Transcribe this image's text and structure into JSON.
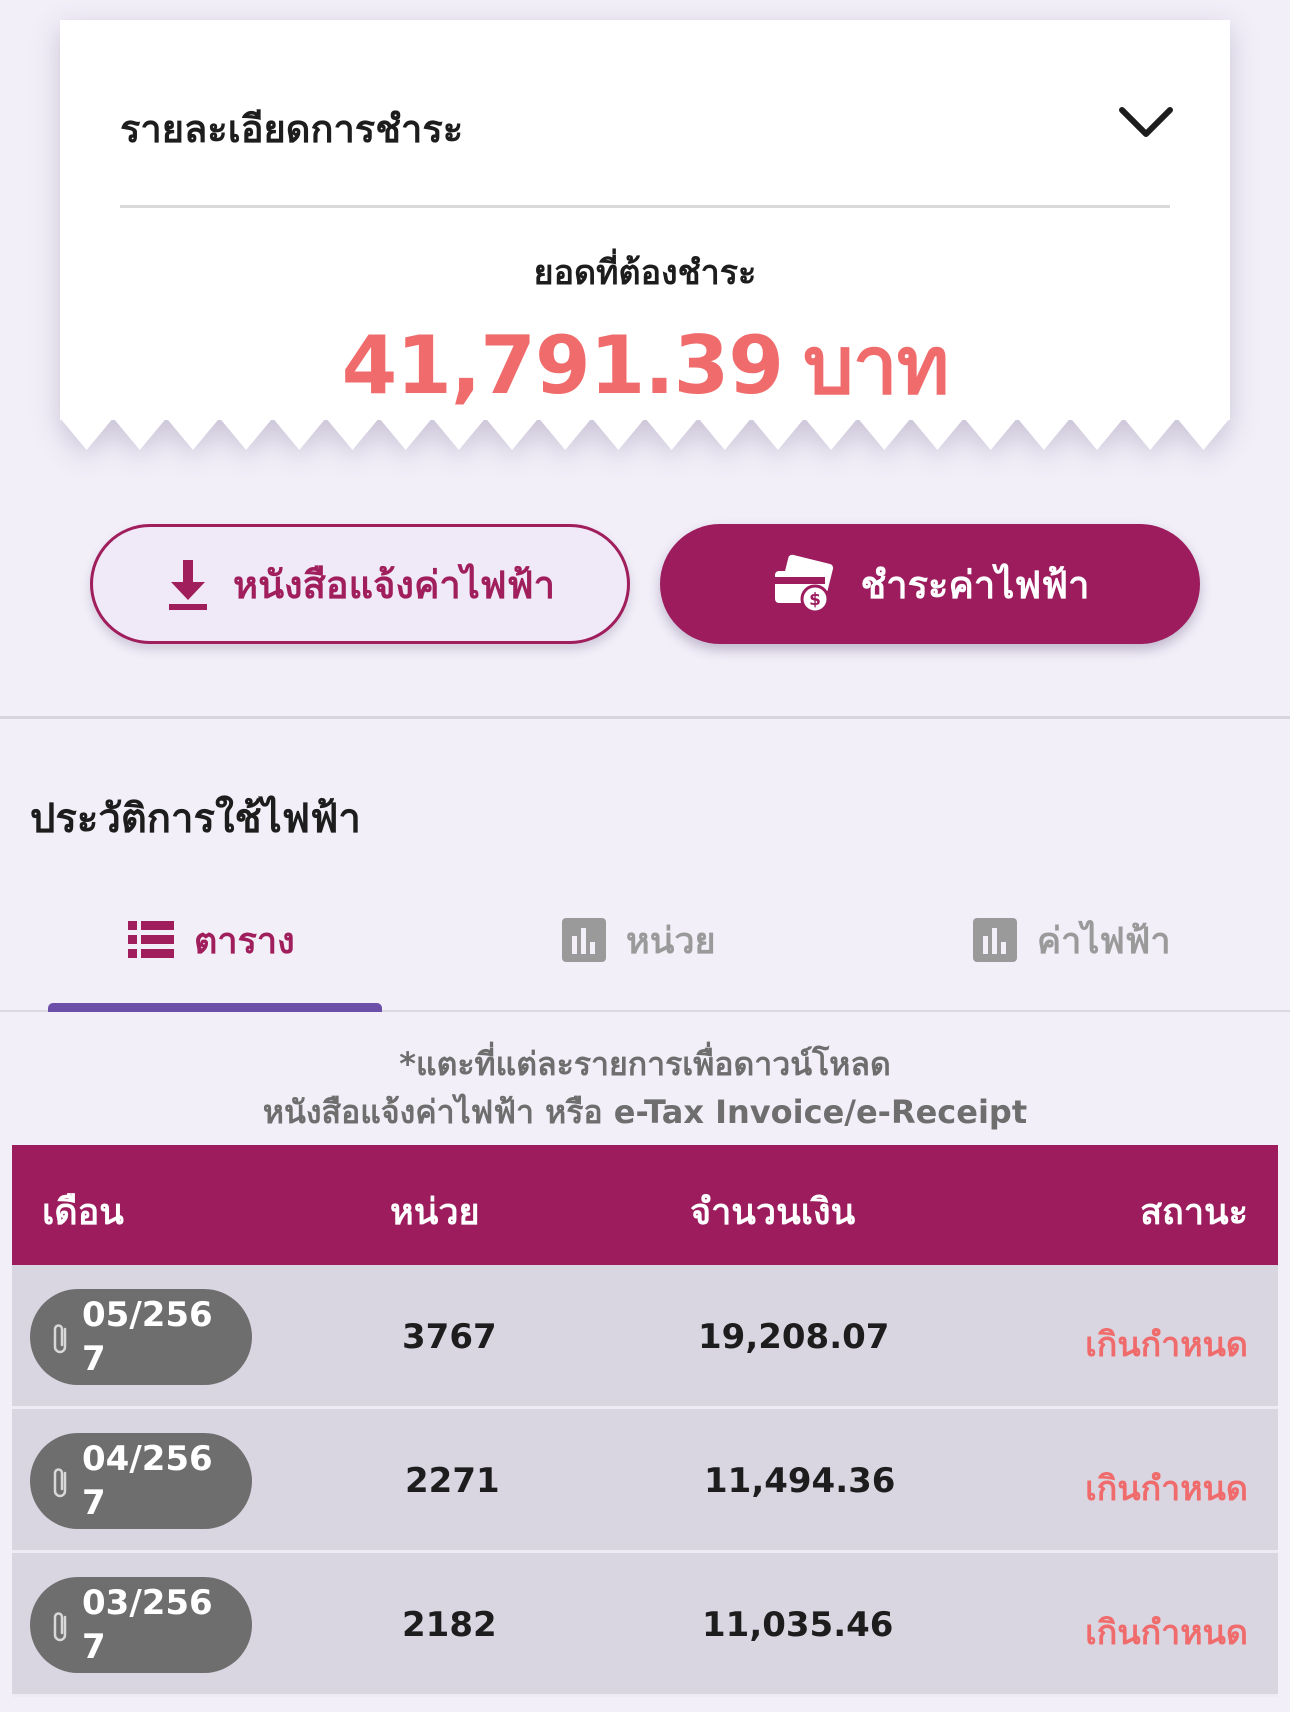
{
  "summary": {
    "title": "รายละเอียดการชำระ",
    "due_label": "ยอดที่ต้องชำระ",
    "due_amount": "41,791.39",
    "currency": "บาท"
  },
  "actions": {
    "download_label": "หนังสือแจ้งค่าไฟฟ้า",
    "pay_label": "ชำระค่าไฟฟ้า"
  },
  "history": {
    "title": "ประวัติการใช้ไฟฟ้า",
    "tabs": [
      {
        "label": "ตาราง",
        "icon": "list-icon",
        "active": true
      },
      {
        "label": "หน่วย",
        "icon": "bar-chart-icon",
        "active": false
      },
      {
        "label": "ค่าไฟฟ้า",
        "icon": "bar-chart-icon",
        "active": false
      }
    ],
    "hint_line1": "*แตะที่แต่ละรายการเพื่อดาวน์โหลด",
    "hint_line2": "หนังสือแจ้งค่าไฟฟ้า หรือ e-Tax Invoice/e-Receipt",
    "columns": [
      "เดือน",
      "หน่วย",
      "จำนวนเงิน",
      "สถานะ"
    ],
    "rows": [
      {
        "month": "05/2567",
        "units": "3767",
        "amount": "19,208.07",
        "status": "เกินกำหนด"
      },
      {
        "month": "04/2567",
        "units": "2271",
        "amount": "11,494.36",
        "status": "เกินกำหนด"
      },
      {
        "month": "03/2567",
        "units": "2182",
        "amount": "11,035.46",
        "status": "เกินกำหนด"
      }
    ]
  },
  "colors": {
    "brand": "#9c1c5e",
    "overdue": "#f06b6b",
    "tab_indicator": "#6b4fa8",
    "background": "#f2eff9"
  }
}
